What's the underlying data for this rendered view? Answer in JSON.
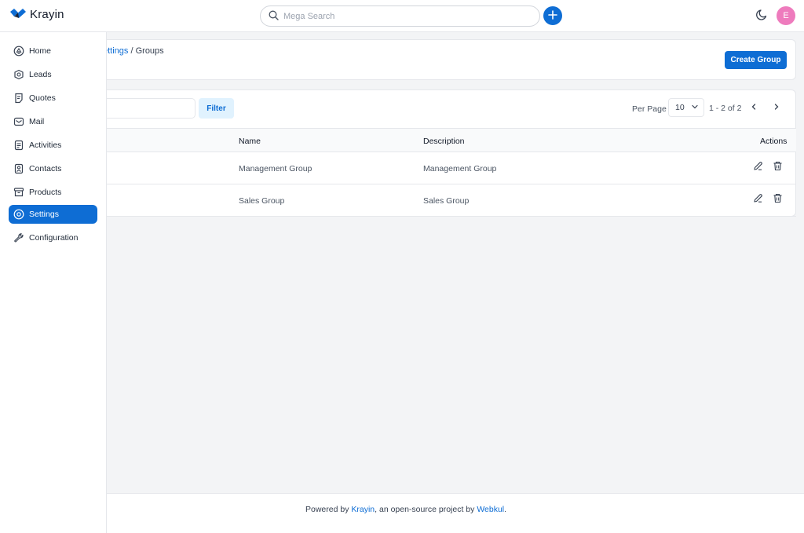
{
  "app": {
    "name": "Krayin"
  },
  "header": {
    "search_placeholder": "Mega Search",
    "avatar_initial": "E"
  },
  "sidebar": {
    "items": [
      {
        "label": "Home",
        "icon": "home-icon",
        "active": false
      },
      {
        "label": "Leads",
        "icon": "leads-icon",
        "active": false
      },
      {
        "label": "Quotes",
        "icon": "quotes-icon",
        "active": false
      },
      {
        "label": "Mail",
        "icon": "mail-icon",
        "active": false
      },
      {
        "label": "Activities",
        "icon": "activities-icon",
        "active": false
      },
      {
        "label": "Contacts",
        "icon": "contacts-icon",
        "active": false
      },
      {
        "label": "Products",
        "icon": "products-icon",
        "active": false
      },
      {
        "label": "Settings",
        "icon": "settings-icon",
        "active": true
      },
      {
        "label": "Configuration",
        "icon": "configuration-icon",
        "active": false
      }
    ]
  },
  "breadcrumb": {
    "parent": "ettings",
    "separator": " / ",
    "current": "Groups"
  },
  "actions": {
    "create_label": "Create Group"
  },
  "toolbar": {
    "filter_label": "Filter",
    "per_page_label": "Per Page",
    "per_page_value": "10",
    "page_info": "1 - 2 of 2"
  },
  "table": {
    "columns": [
      "Name",
      "Description",
      "Actions"
    ],
    "rows": [
      {
        "name": "Management Group",
        "description": "Management Group"
      },
      {
        "name": "Sales Group",
        "description": "Sales Group"
      }
    ]
  },
  "footer": {
    "prefix": "Powered by ",
    "brand": "Krayin",
    "middle": ", an open-source project by ",
    "company": "Webkul",
    "suffix": "."
  },
  "colors": {
    "accent": "#0e6dd4",
    "avatar": "#ee7bbd",
    "filter_bg": "#e0f2fe"
  }
}
